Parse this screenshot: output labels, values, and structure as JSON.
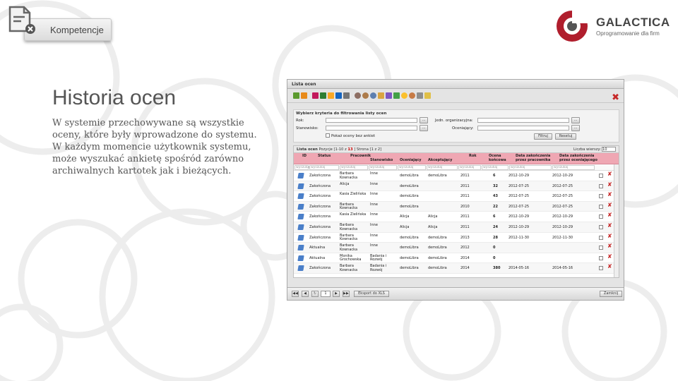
{
  "header": {
    "tab_label": "Kompetencje"
  },
  "logo": {
    "name": "GALACTICA",
    "tagline": "Oprogramowanie dla firm"
  },
  "main": {
    "title": "Historia ocen",
    "description": "W systemie przechowywane są wszystkie oceny, które były wprowadzone do systemu. W każdym momencie użytkownik systemu, może wyszukać ankietę spośród zarówno archiwalnych kartotek jak i bieżących."
  },
  "window": {
    "title": "Lista ocen",
    "filters": {
      "heading": "Wybierz kryteria do filtrowania listy ocen",
      "rok": "Rok:",
      "stanowisko": "Stanowisko:",
      "jednostka": "Jedn. organizacyjna:",
      "oceniajacy": "Oceniający:",
      "pokaz": "Pokaż oceny bez ankiet",
      "filtruj": "Filtruj",
      "resetuj": "Resetuj",
      "dots": "..."
    },
    "grid": {
      "caption_name": "Lista ocen",
      "caption_pos": "Pozycje [1-10 z",
      "caption_total": "13",
      "caption_page": "] Strona [1 z 2]",
      "rows_label": "Liczba wierszy:",
      "rows_value": "10",
      "headers": [
        "ID",
        "Status",
        "Pracownik",
        "Stanowisko",
        "Oceniający",
        "Akceptujący",
        "Rok",
        "Ocena końcowa",
        "Data zakończenia przez pracownika",
        "Data zakończenia przez oceniającego"
      ],
      "filter_placeholder": "wyszukaj",
      "rows": [
        {
          "status": "Zakończona",
          "pracownik": "Barbara Kownacka",
          "stanowisko": "Inne",
          "oceniajacy": "demoLibra",
          "akceptujacy": "demoLibra",
          "rok": "2011",
          "ocena": "6",
          "data1": "2012-10-29",
          "data2": "2012-10-29"
        },
        {
          "status": "Zakończona",
          "pracownik": "Alicja",
          "stanowisko": "Inne",
          "oceniajacy": "demoLibra",
          "akceptujacy": "",
          "rok": "2011",
          "ocena": "32",
          "data1": "2012-07-25",
          "data2": "2012-07-25"
        },
        {
          "status": "Zakończona",
          "pracownik": "Kasia Zielińska",
          "stanowisko": "Inne",
          "oceniajacy": "demoLibra",
          "akceptujacy": "",
          "rok": "2011",
          "ocena": "43",
          "data1": "2012-07-25",
          "data2": "2012-07-25"
        },
        {
          "status": "Zakończona",
          "pracownik": "Barbara Kownacka",
          "stanowisko": "Inne",
          "oceniajacy": "demoLibra",
          "akceptujacy": "",
          "rok": "2010",
          "ocena": "22",
          "data1": "2012-07-25",
          "data2": "2012-07-25"
        },
        {
          "status": "Zakończona",
          "pracownik": "Kasia Zielińska",
          "stanowisko": "Inne",
          "oceniajacy": "Alicja",
          "akceptujacy": "Alicja",
          "rok": "2011",
          "ocena": "6",
          "data1": "2012-10-29",
          "data2": "2012-10-29"
        },
        {
          "status": "Zakończona",
          "pracownik": "Barbara Kownacka",
          "stanowisko": "Inne",
          "oceniajacy": "Alicja",
          "akceptujacy": "Alicja",
          "rok": "2011",
          "ocena": "24",
          "data1": "2012-10-29",
          "data2": "2012-10-29"
        },
        {
          "status": "Zakończona",
          "pracownik": "Barbara Kownacka",
          "stanowisko": "Inne",
          "oceniajacy": "demoLibra",
          "akceptujacy": "demoLibra",
          "rok": "2013",
          "ocena": "28",
          "data1": "2012-11-30",
          "data2": "2012-11-30"
        },
        {
          "status": "Aktualna",
          "pracownik": "Barbara Kownacka",
          "stanowisko": "Inne",
          "oceniajacy": "demoLibra",
          "akceptujacy": "demoLibra",
          "rok": "2012",
          "ocena": "0",
          "data1": "",
          "data2": ""
        },
        {
          "status": "Aktualna",
          "pracownik": "Monika Grochowska",
          "stanowisko": "Badania i Rozwój",
          "oceniajacy": "demoLibra",
          "akceptujacy": "demoLibra",
          "rok": "2014",
          "ocena": "0",
          "data1": "",
          "data2": ""
        },
        {
          "status": "Zakończona",
          "pracownik": "Barbara Kownacka",
          "stanowisko": "Badania i Rozwój",
          "oceniajacy": "demoLibra",
          "akceptujacy": "demoLibra",
          "rok": "2014",
          "ocena": "380",
          "data1": "2014-05-16",
          "data2": "2014-05-16"
        }
      ]
    },
    "pager": {
      "page": "1",
      "export": "Eksport do XLS",
      "close": "Zamknij"
    }
  }
}
